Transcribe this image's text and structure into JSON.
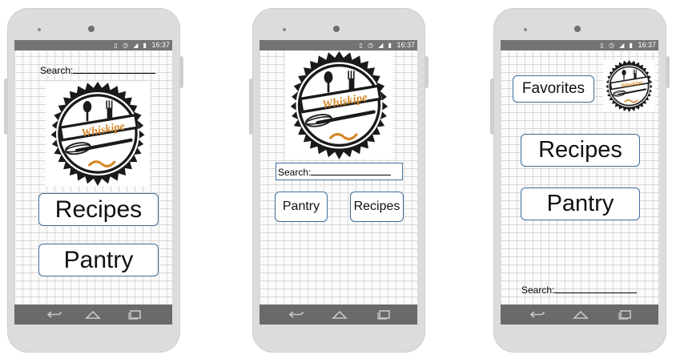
{
  "status_bar": {
    "time": "16:37",
    "icons": [
      "vibrate-icon",
      "alarm-icon",
      "signal-icon",
      "battery-icon"
    ]
  },
  "app": {
    "logo_text": "Whiskipe"
  },
  "screen1": {
    "search_label": "Search:",
    "recipes_label": "Recipes",
    "pantry_label": "Pantry"
  },
  "screen2": {
    "search_label": "Search:",
    "pantry_label": "Pantry",
    "recipes_label": "Recipes"
  },
  "screen3": {
    "favorites_label": "Favorites",
    "recipes_label": "Recipes",
    "pantry_label": "Pantry",
    "search_label": "Search:"
  },
  "colors": {
    "button_border": "#3f6d9a",
    "status_bar": "#747474",
    "nav_bar": "#6a6a6a",
    "logo_accent": "#d4892a",
    "logo_dark": "#1a1a1a"
  }
}
